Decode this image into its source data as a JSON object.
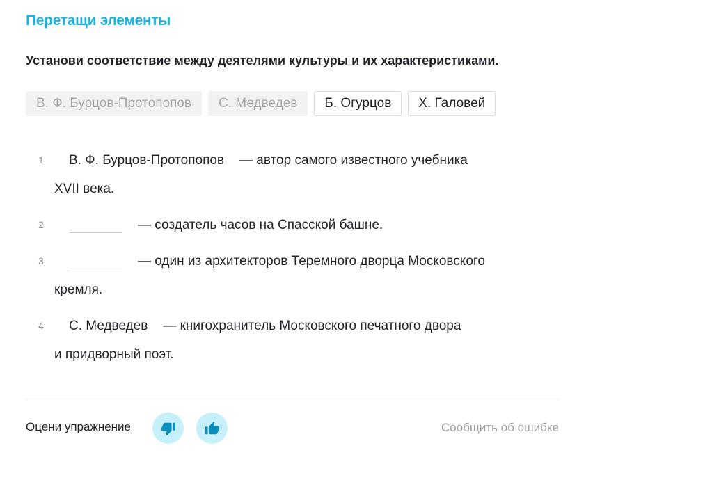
{
  "task_title": "Перетащи элементы",
  "question": "Установи соответствие между деятелями культуры и их характеристиками.",
  "chips": [
    {
      "label": "В. Ф. Бурцов-Протопопов",
      "state": "used"
    },
    {
      "label": "С. Медведев",
      "state": "used"
    },
    {
      "label": "Б. Огурцов",
      "state": "free"
    },
    {
      "label": "Х. Галовей",
      "state": "free"
    }
  ],
  "items": [
    {
      "num": "1",
      "filled": "В. Ф. Бурцов-Протопопов",
      "text": "— автор самого известного учебника",
      "text2": "XVII века."
    },
    {
      "num": "2",
      "filled": "",
      "text": "— создатель часов на Спасской башне."
    },
    {
      "num": "3",
      "filled": "",
      "text": "— один из архитекторов Теремного дворца Московского",
      "text2": "кремля."
    },
    {
      "num": "4",
      "filled": "С. Медведев",
      "text": "— книгохранитель Московского печатного двора",
      "text2": "и придворный поэт."
    }
  ],
  "footer": {
    "rate_label": "Оцени упражнение",
    "dislike_icon": "thumbs-down-icon",
    "like_icon": "thumbs-up-icon",
    "report_label": "Сообщить об ошибке"
  },
  "colors": {
    "accent": "#1ab3e3",
    "vote_bg": "#c6f1fb",
    "icon": "#0d8fbd"
  }
}
